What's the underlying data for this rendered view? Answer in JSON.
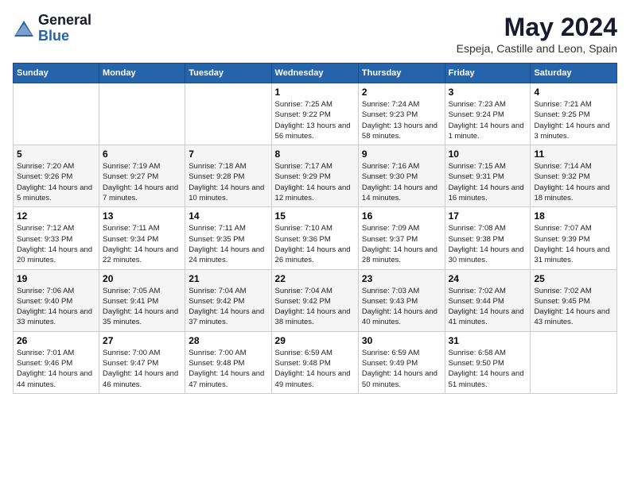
{
  "logo": {
    "general": "General",
    "blue": "Blue"
  },
  "title": "May 2024",
  "location": "Espeja, Castille and Leon, Spain",
  "days_of_week": [
    "Sunday",
    "Monday",
    "Tuesday",
    "Wednesday",
    "Thursday",
    "Friday",
    "Saturday"
  ],
  "weeks": [
    [
      {
        "day": null,
        "info": null
      },
      {
        "day": null,
        "info": null
      },
      {
        "day": null,
        "info": null
      },
      {
        "day": "1",
        "sunrise": "7:25 AM",
        "sunset": "9:22 PM",
        "daylight": "13 hours and 56 minutes."
      },
      {
        "day": "2",
        "sunrise": "7:24 AM",
        "sunset": "9:23 PM",
        "daylight": "13 hours and 58 minutes."
      },
      {
        "day": "3",
        "sunrise": "7:23 AM",
        "sunset": "9:24 PM",
        "daylight": "14 hours and 1 minute."
      },
      {
        "day": "4",
        "sunrise": "7:21 AM",
        "sunset": "9:25 PM",
        "daylight": "14 hours and 3 minutes."
      }
    ],
    [
      {
        "day": "5",
        "sunrise": "7:20 AM",
        "sunset": "9:26 PM",
        "daylight": "14 hours and 5 minutes."
      },
      {
        "day": "6",
        "sunrise": "7:19 AM",
        "sunset": "9:27 PM",
        "daylight": "14 hours and 7 minutes."
      },
      {
        "day": "7",
        "sunrise": "7:18 AM",
        "sunset": "9:28 PM",
        "daylight": "14 hours and 10 minutes."
      },
      {
        "day": "8",
        "sunrise": "7:17 AM",
        "sunset": "9:29 PM",
        "daylight": "14 hours and 12 minutes."
      },
      {
        "day": "9",
        "sunrise": "7:16 AM",
        "sunset": "9:30 PM",
        "daylight": "14 hours and 14 minutes."
      },
      {
        "day": "10",
        "sunrise": "7:15 AM",
        "sunset": "9:31 PM",
        "daylight": "14 hours and 16 minutes."
      },
      {
        "day": "11",
        "sunrise": "7:14 AM",
        "sunset": "9:32 PM",
        "daylight": "14 hours and 18 minutes."
      }
    ],
    [
      {
        "day": "12",
        "sunrise": "7:12 AM",
        "sunset": "9:33 PM",
        "daylight": "14 hours and 20 minutes."
      },
      {
        "day": "13",
        "sunrise": "7:11 AM",
        "sunset": "9:34 PM",
        "daylight": "14 hours and 22 minutes."
      },
      {
        "day": "14",
        "sunrise": "7:11 AM",
        "sunset": "9:35 PM",
        "daylight": "14 hours and 24 minutes."
      },
      {
        "day": "15",
        "sunrise": "7:10 AM",
        "sunset": "9:36 PM",
        "daylight": "14 hours and 26 minutes."
      },
      {
        "day": "16",
        "sunrise": "7:09 AM",
        "sunset": "9:37 PM",
        "daylight": "14 hours and 28 minutes."
      },
      {
        "day": "17",
        "sunrise": "7:08 AM",
        "sunset": "9:38 PM",
        "daylight": "14 hours and 30 minutes."
      },
      {
        "day": "18",
        "sunrise": "7:07 AM",
        "sunset": "9:39 PM",
        "daylight": "14 hours and 31 minutes."
      }
    ],
    [
      {
        "day": "19",
        "sunrise": "7:06 AM",
        "sunset": "9:40 PM",
        "daylight": "14 hours and 33 minutes."
      },
      {
        "day": "20",
        "sunrise": "7:05 AM",
        "sunset": "9:41 PM",
        "daylight": "14 hours and 35 minutes."
      },
      {
        "day": "21",
        "sunrise": "7:04 AM",
        "sunset": "9:42 PM",
        "daylight": "14 hours and 37 minutes."
      },
      {
        "day": "22",
        "sunrise": "7:04 AM",
        "sunset": "9:42 PM",
        "daylight": "14 hours and 38 minutes."
      },
      {
        "day": "23",
        "sunrise": "7:03 AM",
        "sunset": "9:43 PM",
        "daylight": "14 hours and 40 minutes."
      },
      {
        "day": "24",
        "sunrise": "7:02 AM",
        "sunset": "9:44 PM",
        "daylight": "14 hours and 41 minutes."
      },
      {
        "day": "25",
        "sunrise": "7:02 AM",
        "sunset": "9:45 PM",
        "daylight": "14 hours and 43 minutes."
      }
    ],
    [
      {
        "day": "26",
        "sunrise": "7:01 AM",
        "sunset": "9:46 PM",
        "daylight": "14 hours and 44 minutes."
      },
      {
        "day": "27",
        "sunrise": "7:00 AM",
        "sunset": "9:47 PM",
        "daylight": "14 hours and 46 minutes."
      },
      {
        "day": "28",
        "sunrise": "7:00 AM",
        "sunset": "9:48 PM",
        "daylight": "14 hours and 47 minutes."
      },
      {
        "day": "29",
        "sunrise": "6:59 AM",
        "sunset": "9:48 PM",
        "daylight": "14 hours and 49 minutes."
      },
      {
        "day": "30",
        "sunrise": "6:59 AM",
        "sunset": "9:49 PM",
        "daylight": "14 hours and 50 minutes."
      },
      {
        "day": "31",
        "sunrise": "6:58 AM",
        "sunset": "9:50 PM",
        "daylight": "14 hours and 51 minutes."
      },
      {
        "day": null,
        "info": null
      }
    ]
  ],
  "labels": {
    "sunrise": "Sunrise:",
    "sunset": "Sunset:",
    "daylight": "Daylight:"
  }
}
